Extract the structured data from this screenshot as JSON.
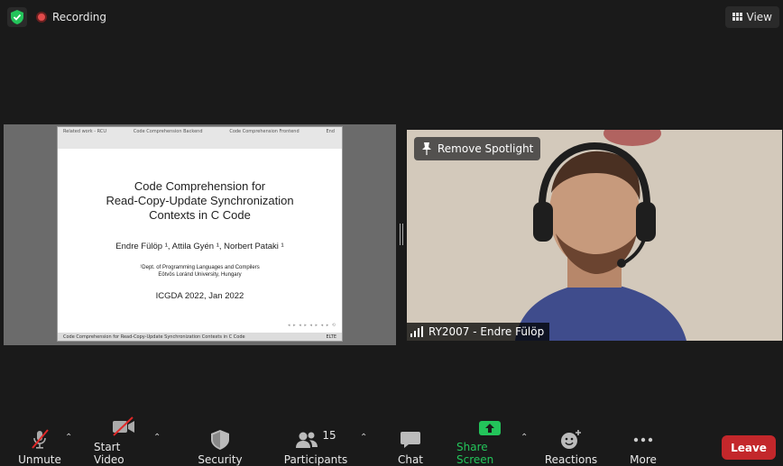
{
  "topbar": {
    "recording_label": "Recording",
    "view_label": "View"
  },
  "slide": {
    "nav": [
      "Related work - RCU",
      "Code Comprehension Backend",
      "Code Comprehension Frontend",
      "End"
    ],
    "title_lines": [
      "Code Comprehension for",
      "Read-Copy-Update Synchronization",
      "Contexts in C Code"
    ],
    "authors": "Endre Fülöp ¹, Attila Gyén ¹, Norbert Pataki ¹",
    "affiliation_lines": [
      "¹Dept. of Programming Languages and Compilers",
      "Eötvös Loránd University, Hungary"
    ],
    "conference": "ICGDA 2022, Jan 2022",
    "footer_left": "Code Comprehension for Read-Copy-Update Synchronization Contexts in C Code",
    "footer_right": "ELTE"
  },
  "video": {
    "spotlight_label": "Remove Spotlight",
    "participant_name": "RY2007 - Endre Fülöp"
  },
  "toolbar": {
    "unmute_label": "Unmute",
    "start_video_label": "Start Video",
    "security_label": "Security",
    "participants_label": "Participants",
    "participants_count": "15",
    "chat_label": "Chat",
    "share_screen_label": "Share Screen",
    "reactions_label": "Reactions",
    "more_label": "More",
    "leave_label": "Leave"
  },
  "colors": {
    "background": "#1a1a1a",
    "share_green": "#23c45a",
    "leave_red": "#c3272b",
    "shield_green": "#23c45a",
    "muted_red": "#e02828"
  }
}
